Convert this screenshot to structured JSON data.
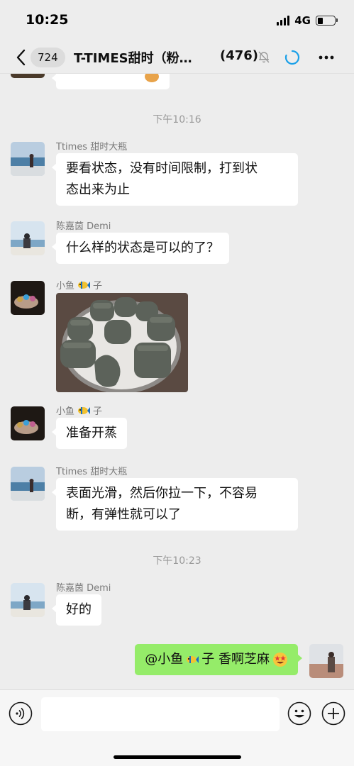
{
  "status_bar": {
    "time": "10:25",
    "network": "4G"
  },
  "nav": {
    "unread_count": "724",
    "title": "T-TIMES甜时（粉…",
    "member_count": "(476)"
  },
  "messages": [
    {
      "type": "timestamp",
      "text": "下午10:16"
    },
    {
      "type": "text",
      "sender": "Ttimes 甜时大瓶",
      "line1": "要看状态，没有时间限制，打到状",
      "line2": "态出来为止"
    },
    {
      "type": "text",
      "sender": "陈嘉茵 Demi",
      "text": "什么样的状态是可以的了？"
    },
    {
      "type": "image",
      "sender_prefix": "小鱼",
      "sender_suffix": "子"
    },
    {
      "type": "text",
      "sender_prefix": "小鱼",
      "sender_suffix": "子",
      "text": "准备开蒸"
    },
    {
      "type": "text",
      "sender": "Ttimes 甜时大瓶",
      "line1": "表面光滑，然后你拉一下，不容易",
      "line2": "断，有弹性就可以了"
    },
    {
      "type": "timestamp",
      "text": "下午10:23"
    },
    {
      "type": "text",
      "sender": "陈嘉茵 Demi",
      "text": "好的"
    },
    {
      "type": "self",
      "mention": "@小鱼",
      "rest": "子 香啊芝麻"
    }
  ],
  "icons": {
    "back": "chevron-left-icon",
    "mute": "bell-muted-icon",
    "loading": "loading-spinner-icon",
    "more": "more-dots-icon",
    "voice": "voice-icon",
    "emoji": "emoji-icon",
    "plus": "plus-icon",
    "fish": "fish-emoji-icon",
    "star_eyes": "star-struck-emoji-icon"
  },
  "colors": {
    "background": "#ededed",
    "self_bubble": "#95ec69",
    "bubble": "#ffffff",
    "accent": "#1aa0e8"
  }
}
